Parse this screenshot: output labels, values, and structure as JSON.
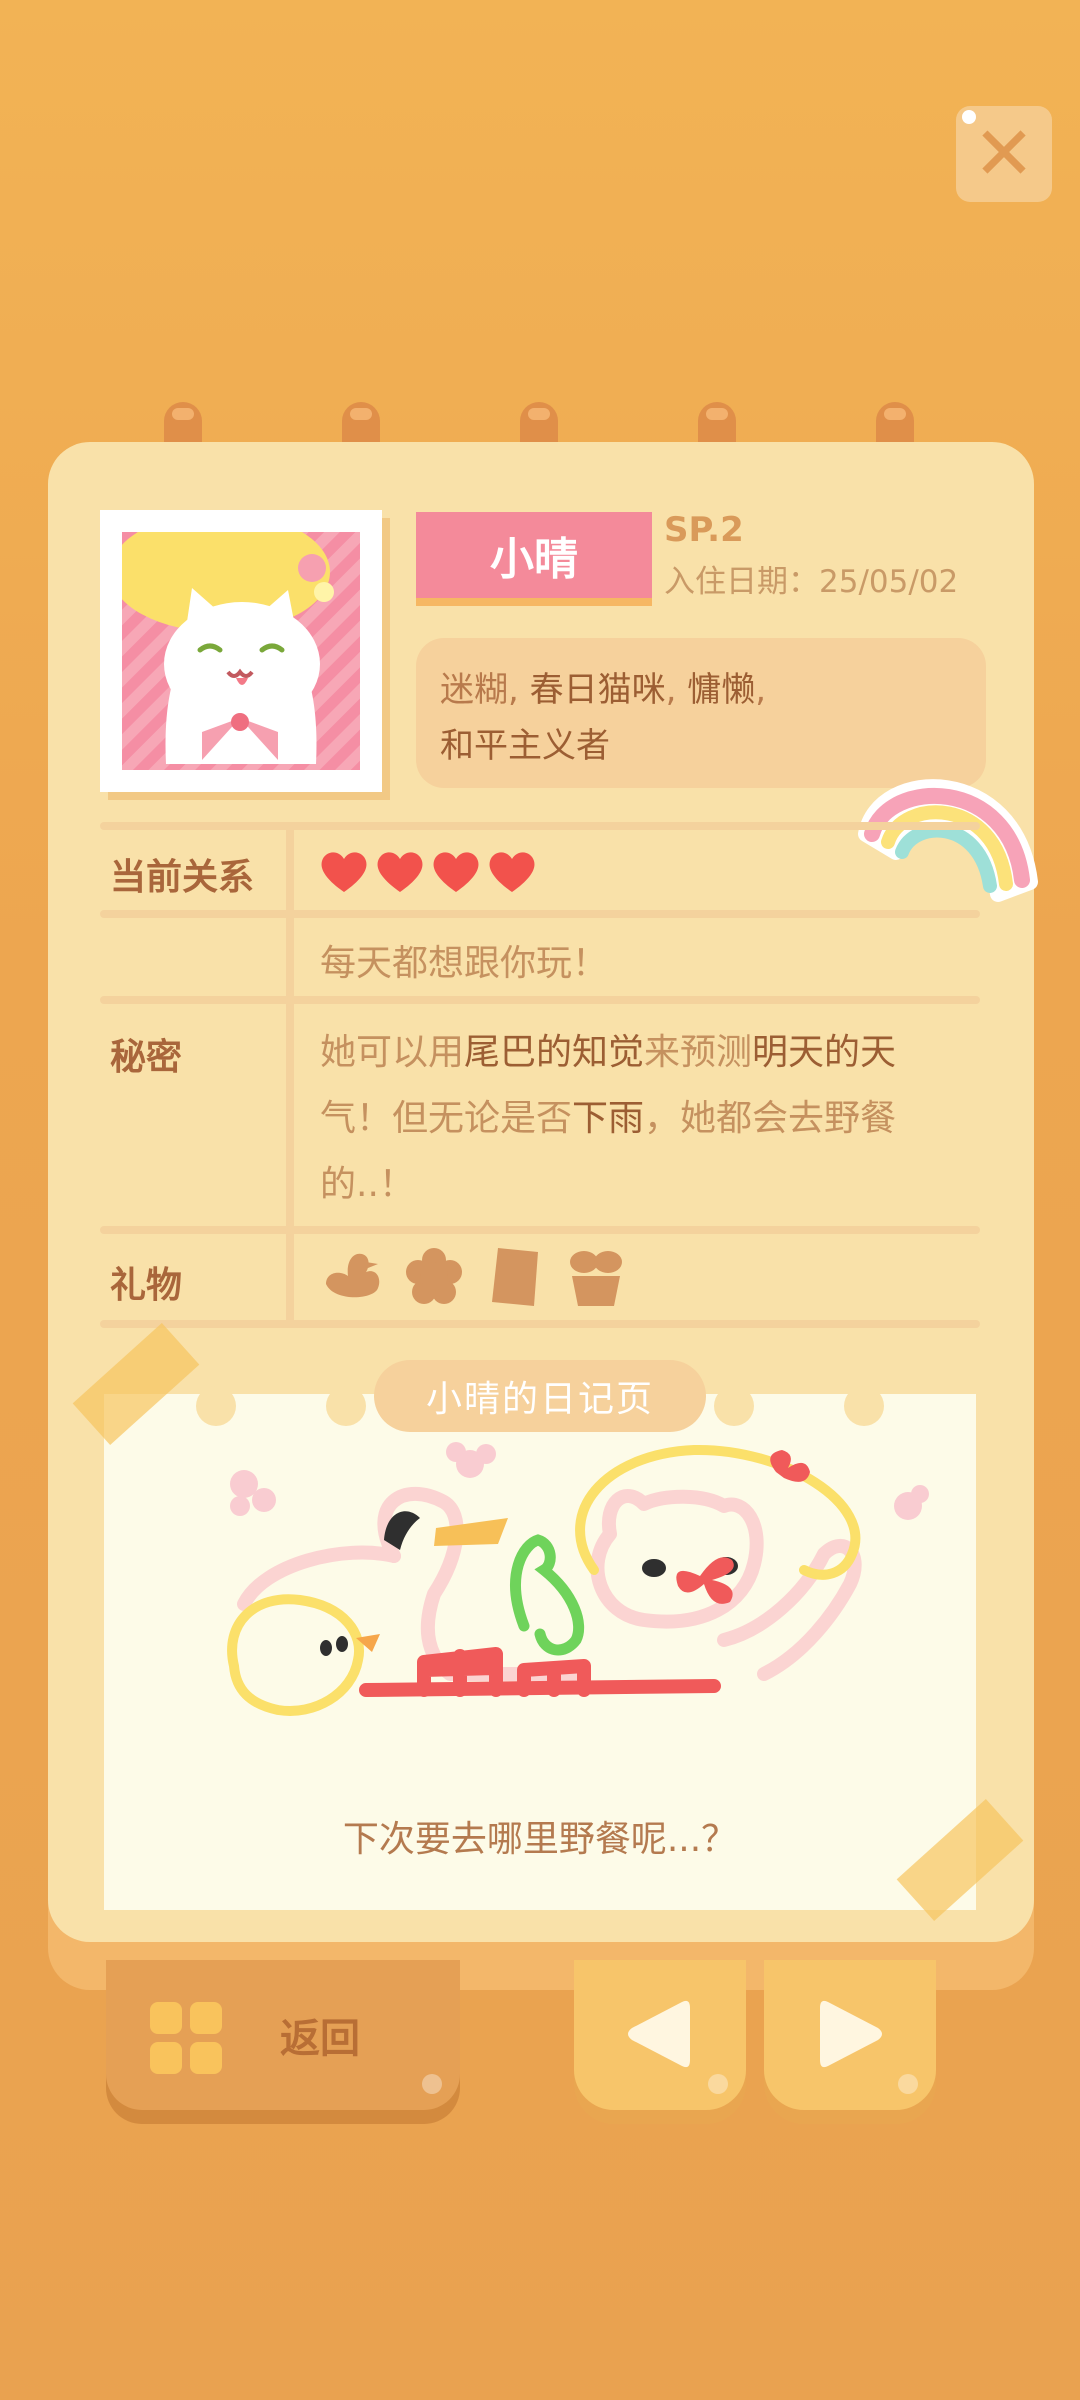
{
  "character": {
    "name": "小晴",
    "series": "SP.2",
    "checkin_label": "入住日期：",
    "checkin_date": "25/05/02",
    "traits": {
      "t1": "迷糊",
      "sep": ", ",
      "t2": "春日猫咪",
      "t3": "慵懒",
      "t4": "和平主义者",
      "comma": ","
    }
  },
  "relation": {
    "label": "当前关系",
    "hearts": 4,
    "note": "每天都想跟你玩！"
  },
  "secret": {
    "label": "秘密",
    "s1": "她可以用",
    "s2": "尾巴的知觉",
    "s3": "来预测",
    "s4": "明天的天",
    "s5": "气！但无论是否",
    "s6": "下雨",
    "s7": "，她都会去野餐",
    "s8": "的..！"
  },
  "gifts": {
    "label": "礼物",
    "items": [
      "duck-gift-icon",
      "flower-gift-icon",
      "book-gift-icon",
      "plant-gift-icon"
    ]
  },
  "diary": {
    "title": "小晴的日记页",
    "caption": "下次要去哪里野餐呢...？"
  },
  "nav": {
    "back_label": "返回"
  },
  "colors": {
    "name_tag": "#f48a9a",
    "heart": "#f2524c",
    "background": "#eda650"
  }
}
